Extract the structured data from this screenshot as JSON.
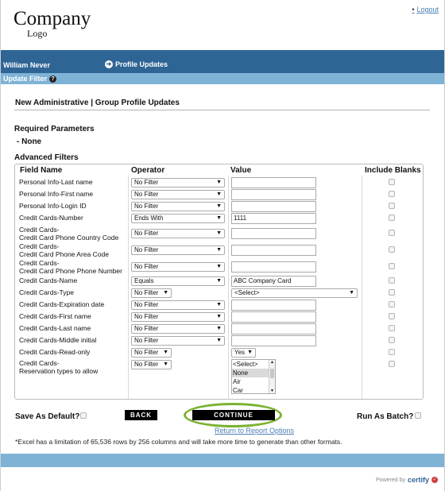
{
  "header": {
    "logo_line1": "Company",
    "logo_line2": "Logo",
    "logout": "Logout"
  },
  "topbar": {
    "user_name": "William Never",
    "profile_updates": "Profile Updates"
  },
  "subbar": {
    "label": "Update Filter"
  },
  "page": {
    "title": "New Administrative | Group Profile Updates",
    "required_heading": "Required Parameters",
    "required_value": "- None",
    "advanced_heading": "Advanced Filters"
  },
  "columns": {
    "field_name": "Field Name",
    "operator": "Operator",
    "value": "Value",
    "include_blanks": "Include Blanks"
  },
  "rows": [
    {
      "field": [
        "Personal Info-Last name"
      ],
      "operator": "No Filter",
      "value": ""
    },
    {
      "field": [
        "Personal Info-First name"
      ],
      "operator": "No Filter",
      "value": ""
    },
    {
      "field": [
        "Personal Info-Login ID"
      ],
      "operator": "No Filter",
      "value": ""
    },
    {
      "field": [
        "Credit Cards-Number"
      ],
      "operator": "Ends With",
      "value": "1111"
    },
    {
      "field": [
        "Credit Cards-",
        "Credit Card Phone Country Code"
      ],
      "operator": "No Filter",
      "value": ""
    },
    {
      "field": [
        "Credit Cards-",
        "Credit Card Phone Area Code"
      ],
      "operator": "No Filter",
      "value": ""
    },
    {
      "field": [
        "Credit Cards-",
        "Credit Card Phone Phone Number"
      ],
      "operator": "No Filter",
      "value": ""
    },
    {
      "field": [
        "Credit Cards-Name"
      ],
      "operator": "Equals",
      "value": "ABC Company Card"
    },
    {
      "field": [
        "Credit Cards-Type"
      ],
      "operator": "No Filter",
      "value": "<Select>"
    },
    {
      "field": [
        "Credit Cards-Expiration date"
      ],
      "operator": "No Filter",
      "value": ""
    },
    {
      "field": [
        "Credit Cards-First name"
      ],
      "operator": "No Filter",
      "value": ""
    },
    {
      "field": [
        "Credit Cards-Last name"
      ],
      "operator": "No Filter",
      "value": ""
    },
    {
      "field": [
        "Credit Cards-Middle initial"
      ],
      "operator": "No Filter",
      "value": ""
    },
    {
      "field": [
        "Credit Cards-Read-only"
      ],
      "operator": "No Filter",
      "value": "Yes"
    },
    {
      "field": [
        "Credit Cards-",
        "Reservation types to allow"
      ],
      "operator": "No Filter",
      "value": ""
    }
  ],
  "reservation_options": [
    "<Select>",
    "None",
    "Air",
    "Car"
  ],
  "footer": {
    "save_default": "Save As Default?",
    "back": "BACK",
    "continue": "CONTINUE",
    "run_batch": "Run As Batch?",
    "return_link": "Return to Report Options",
    "note": "*Excel has a limitation of 65,536 rows by 256 columns and will take more time to generate than other formats.",
    "powered_by": "Powered by",
    "brand": "certify"
  },
  "colors": {
    "topbar": "#2f6595",
    "subbar": "#7fb3d6",
    "link": "#4a7fb5",
    "highlight_ring": "#7bb231"
  }
}
